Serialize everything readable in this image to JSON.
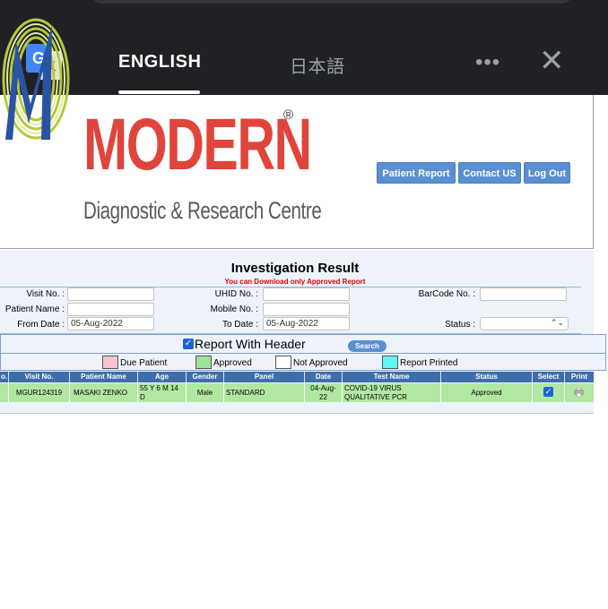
{
  "translate_bar": {
    "lang_source": "ENGLISH",
    "lang_target": "日本語",
    "more_glyph": "•••",
    "close_glyph": "✕"
  },
  "header": {
    "brand_name": "MODERN",
    "registered_mark": "®",
    "tagline": "Diagnostic & Research Centre",
    "buttons": {
      "patient_report": "Patient Report",
      "contact_us": "Contact US",
      "log_out": "Log Out"
    }
  },
  "search": {
    "title": "Investigation Result",
    "subtitle": "You can Download only Approved Report",
    "visit_no_label": "Visit No. :",
    "uhid_no_label": "UHID No. :",
    "barcode_no_label": "BarCode No. :",
    "patient_name_label": "Patient Name :",
    "mobile_no_label": "Mobile No. :",
    "from_date_label": "From Date :",
    "from_date_value": "05-Aug-2022",
    "to_date_label": "To Date :",
    "to_date_value": "05-Aug-2022",
    "status_label": "Status :",
    "report_with_header": "Report With Header",
    "search_button": "Search"
  },
  "legend": {
    "due_patient": "Due Patient",
    "approved": "Approved",
    "not_approved": "Not Approved",
    "report_printed": "Report Printed",
    "colors": {
      "due_patient": "#f6c3cf",
      "approved": "#9ee39a",
      "not_approved": "#ffffff",
      "report_printed": "#5ff6f4"
    }
  },
  "table": {
    "columns": [
      "o.",
      "Visit No.",
      "Patient Name",
      "Age",
      "Gender",
      "Panel",
      "Date",
      "Test Name",
      "Status",
      "Select",
      "Print"
    ],
    "rows": [
      {
        "visit_no": "MGUR124319",
        "patient_name": "MASAKI ZENKO",
        "age_line1": "55 Y 6 M 14",
        "age_line2": "D",
        "gender": "Male",
        "panel": "STANDARD",
        "date_line1": "04-Aug-",
        "date_line2": "22",
        "test_line1": "COVID-19 VIRUS",
        "test_line2": "QUALITATIVE PCR",
        "status": "Approved"
      }
    ]
  },
  "colors": {
    "accent": "#5b8fd1",
    "table_header": "#3e6ea9",
    "brand_red": "#e0443a",
    "row_approved": "#b1e8a1"
  }
}
